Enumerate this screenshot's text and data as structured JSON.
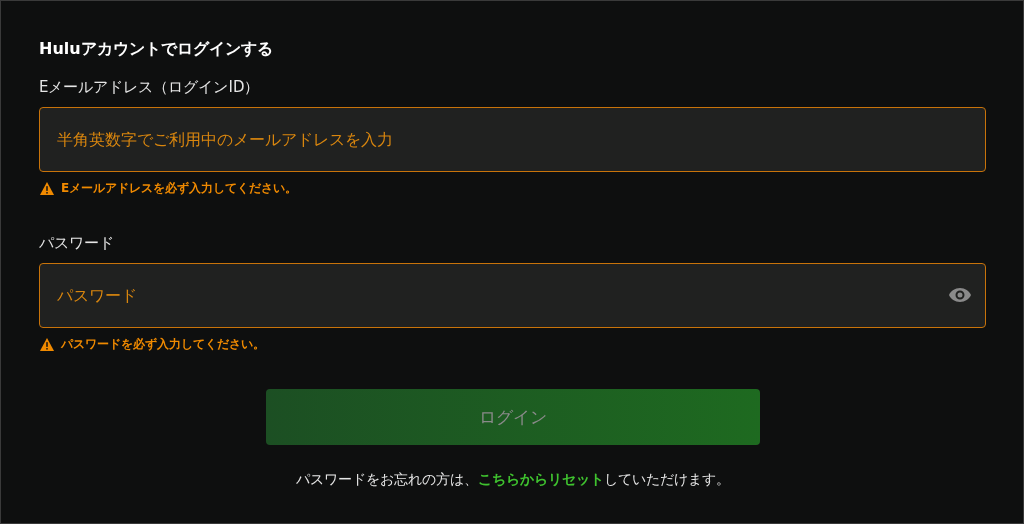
{
  "title": "Huluアカウントでログインする",
  "fields": [
    {
      "kind": "email",
      "label": "Eメールアドレス（ログインID）",
      "placeholder": "半角英数字でご利用中のメールアドレスを入力",
      "invalid": true,
      "error": "Eメールアドレスを必ず入力してください。"
    },
    {
      "kind": "password",
      "label": "パスワード",
      "placeholder": "パスワード",
      "invalid": true,
      "error": "パスワードを必ず入力してください。"
    }
  ],
  "login_button": {
    "label": "ログイン",
    "disabled": true
  },
  "footer": {
    "before": "パスワードをお忘れの方は、",
    "link": "こちらからリセット",
    "after": "していただけます。"
  }
}
